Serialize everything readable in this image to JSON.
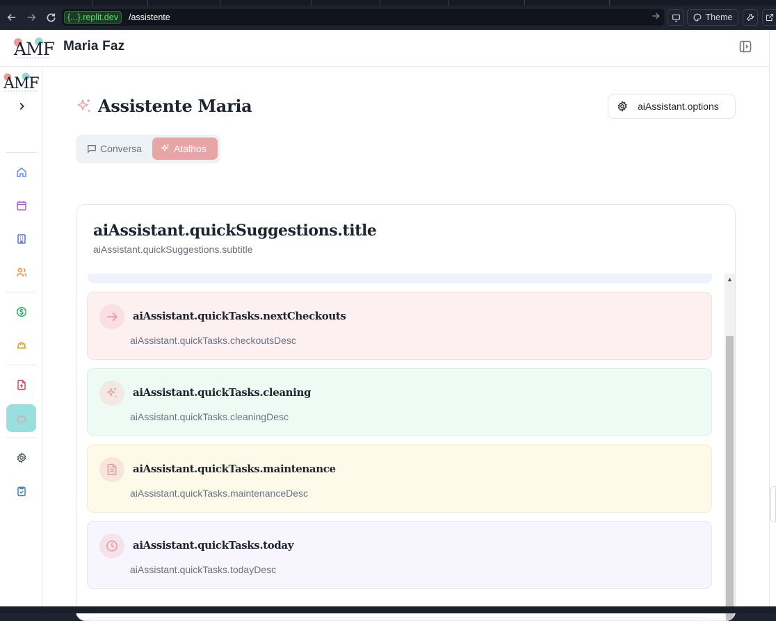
{
  "browser": {
    "url_host": "{...}.replit.dev",
    "url_path": "/assistente",
    "theme_label": "Theme"
  },
  "header": {
    "brand": "Maria Faz",
    "logo_text": "AMF"
  },
  "page": {
    "title": "Assistente Maria",
    "options_label": "aiAssistant.options"
  },
  "tabs": [
    {
      "label": "Conversa",
      "active": false
    },
    {
      "label": "Atalhos",
      "active": true
    }
  ],
  "card": {
    "title": "aiAssistant.quickSuggestions.title",
    "subtitle": "aiAssistant.quickSuggestions.subtitle"
  },
  "tasks": [
    {
      "title": "aiAssistant.quickTasks.nextCheckouts",
      "desc": "aiAssistant.quickTasks.checkoutsDesc",
      "icon": "arrow-right-icon",
      "bg": "#fdf0f1",
      "border": "#f8dede",
      "iconbg": "#f9dfe1"
    },
    {
      "title": "aiAssistant.quickTasks.cleaning",
      "desc": "aiAssistant.quickTasks.cleaningDesc",
      "icon": "sparkles-icon",
      "bg": "#edfbf4",
      "border": "#d6f2e3",
      "iconbg": "#f3e8e6"
    },
    {
      "title": "aiAssistant.quickTasks.maintenance",
      "desc": "aiAssistant.quickTasks.maintenanceDesc",
      "icon": "file-text-icon",
      "bg": "#fefae9",
      "border": "#f5ecc6",
      "iconbg": "#f6e6dc"
    },
    {
      "title": "aiAssistant.quickTasks.today",
      "desc": "aiAssistant.quickTasks.todayDesc",
      "icon": "clock-icon",
      "bg": "#f7f5fd",
      "border": "#e9e4f7",
      "iconbg": "#f4e3ea"
    }
  ],
  "colors": {
    "accent": "#e8a5a5",
    "active_nav": "#9adfdf",
    "icon_red": "#e8a0a0"
  }
}
